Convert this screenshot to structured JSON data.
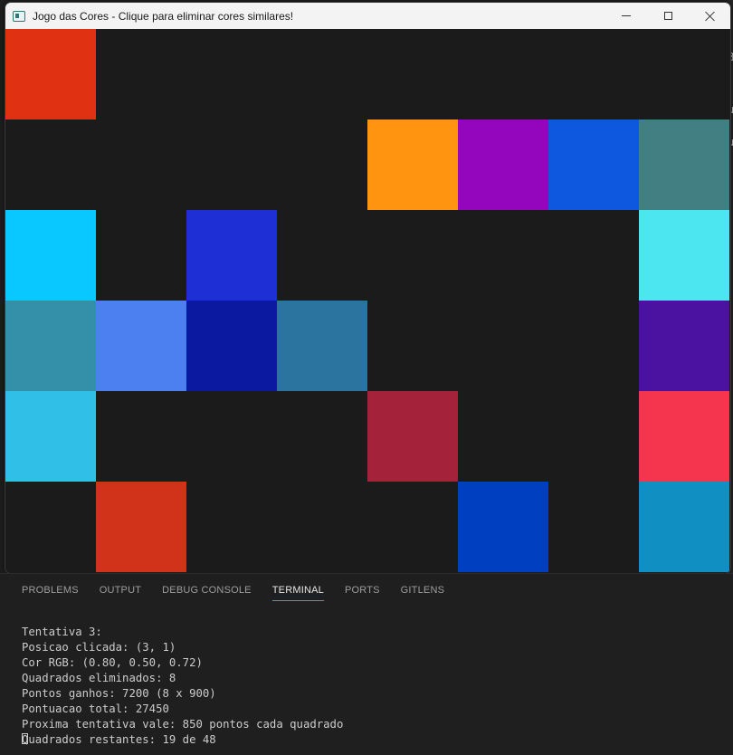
{
  "window": {
    "title": "Jogo das Cores - Clique para eliminar cores similares!",
    "app_icon": "window-app-icon",
    "controls": {
      "minimize": "minimize-icon",
      "maximize": "maximize-icon",
      "close": "close-icon"
    }
  },
  "board": {
    "columns": 8,
    "rows": 6,
    "background": "#1b1b1b",
    "tiles": [
      {
        "row": 0,
        "col": 0,
        "color": "#e03212"
      },
      {
        "row": 1,
        "col": 4,
        "color": "#ff9410"
      },
      {
        "row": 1,
        "col": 5,
        "color": "#9406bd"
      },
      {
        "row": 1,
        "col": 6,
        "color": "#0e58e0"
      },
      {
        "row": 1,
        "col": 7,
        "color": "#417f82"
      },
      {
        "row": 2,
        "col": 0,
        "color": "#08c8ff"
      },
      {
        "row": 2,
        "col": 2,
        "color": "#1f2fd6"
      },
      {
        "row": 2,
        "col": 7,
        "color": "#4ce6f0"
      },
      {
        "row": 3,
        "col": 0,
        "color": "#348fa8"
      },
      {
        "row": 3,
        "col": 1,
        "color": "#4c7ff0"
      },
      {
        "row": 3,
        "col": 2,
        "color": "#0b18a0"
      },
      {
        "row": 3,
        "col": 3,
        "color": "#2c74a0"
      },
      {
        "row": 3,
        "col": 7,
        "color": "#4b12a2"
      },
      {
        "row": 4,
        "col": 0,
        "color": "#30bfe6"
      },
      {
        "row": 4,
        "col": 4,
        "color": "#a4233a"
      },
      {
        "row": 4,
        "col": 7,
        "color": "#f5354e"
      },
      {
        "row": 5,
        "col": 1,
        "color": "#d0331a"
      },
      {
        "row": 5,
        "col": 5,
        "color": "#0040c0"
      },
      {
        "row": 5,
        "col": 7,
        "color": "#0f8fc2"
      }
    ]
  },
  "panel": {
    "tabs": [
      {
        "label": "PROBLEMS",
        "active": false
      },
      {
        "label": "OUTPUT",
        "active": false
      },
      {
        "label": "DEBUG CONSOLE",
        "active": false
      },
      {
        "label": "TERMINAL",
        "active": true
      },
      {
        "label": "PORTS",
        "active": false
      },
      {
        "label": "GITLENS",
        "active": false
      }
    ],
    "terminal_lines": [
      "Tentativa 3:",
      "Posicao clicada: (3, 1)",
      "Cor RGB: (0.80, 0.50, 0.72)",
      "Quadrados eliminados: 8",
      "Pontos ganhos: 7200 (8 x 900)",
      "Pontuacao total: 27450",
      "Proxima tentativa vale: 850 pontos cada quadrado",
      "Quadrados restantes: 19 de 48"
    ]
  },
  "background_editor": {
    "glyphs": [
      "B",
      "u",
      "u"
    ]
  },
  "colors": {
    "terminal_text": "#cccccc",
    "active_tab_underline": "#3794ff",
    "panel_bg": "#1f1f1f"
  }
}
